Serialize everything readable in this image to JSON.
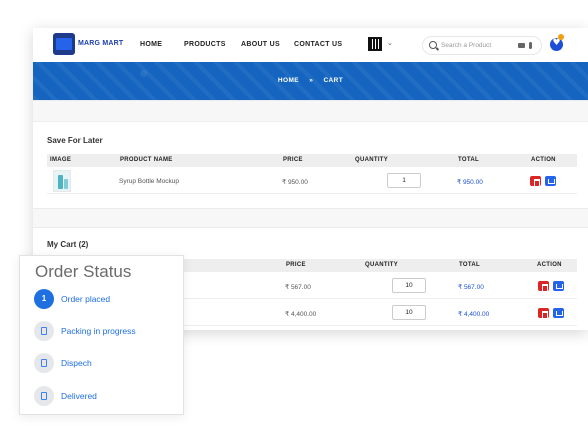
{
  "nav": {
    "brand": "MARG MART",
    "links": [
      "HOME",
      "PRODUCTS",
      "ABOUT US",
      "CONTACT US"
    ],
    "search_placeholder": "Search a Product",
    "wishlist_count": ""
  },
  "banner": {
    "crumb_home": "HOME",
    "crumb_sep": "»",
    "crumb_current": "CART"
  },
  "save_for_later": {
    "title": "Save For Later",
    "headers": [
      "IMAGE",
      "PRODUCT NAME",
      "PRICE",
      "QUANTITY",
      "TOTAL",
      "ACTION"
    ],
    "rows": [
      {
        "name": "Syrup Bottle Mockup",
        "price": "₹ 950.00",
        "qty": "1",
        "total": "₹ 950.00"
      }
    ]
  },
  "my_cart": {
    "title": "My Cart (2)",
    "headers": [
      "PRICE",
      "QUANTITY",
      "TOTAL",
      "ACTION"
    ],
    "rows": [
      {
        "price": "₹ 567.00",
        "qty": "10",
        "total": "₹ 567.00"
      },
      {
        "price": "₹ 4,400.00",
        "qty": "10",
        "total": "₹ 4,400.00"
      }
    ]
  },
  "order_status": {
    "title": "Order Status",
    "steps": [
      {
        "num": "1",
        "label": "Order placed",
        "active": true,
        "icon": "number-badge"
      },
      {
        "label": "Packing in progress",
        "active": false,
        "icon": "package-icon"
      },
      {
        "label": "Dispech",
        "active": false,
        "icon": "truck-icon"
      },
      {
        "label": "Delivered",
        "active": false,
        "icon": "check-icon"
      }
    ]
  },
  "colors": {
    "brand": "#1565c0",
    "accent": "#1e6fe0",
    "danger": "#dc2626"
  }
}
